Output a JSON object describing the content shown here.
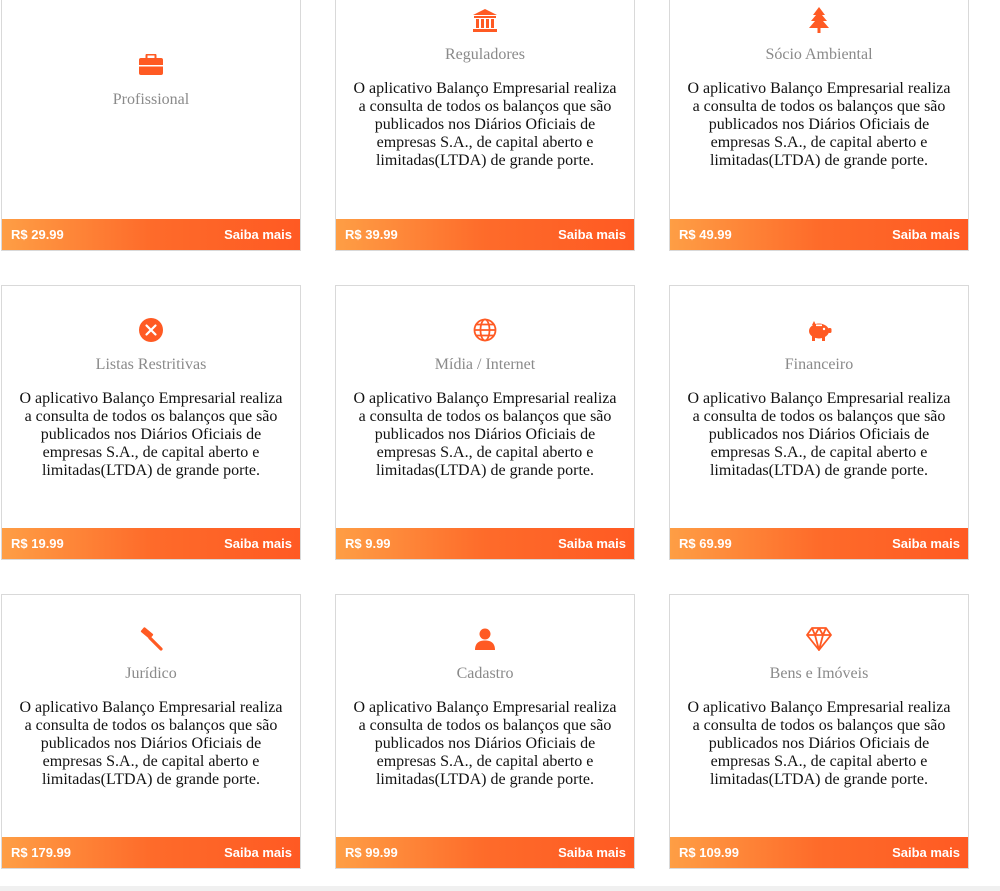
{
  "colors": {
    "accent": "#ff5a23",
    "title_gray": "#8a8a8a"
  },
  "cards": [
    {
      "icon": "briefcase-icon",
      "title": "Profissional",
      "description": "",
      "price": "R$ 29.99",
      "cta": "Saiba mais"
    },
    {
      "icon": "bank-icon",
      "title": "Reguladores",
      "description": "O aplicativo Balanço Empresarial realiza a consulta de todos os balanços que são publicados nos Diários Oficiais de empresas S.A., de capital aberto e limitadas(LTDA) de grande porte.",
      "price": "R$ 39.99",
      "cta": "Saiba mais"
    },
    {
      "icon": "tree-icon",
      "title": "Sócio Ambiental",
      "description": "O aplicativo Balanço Empresarial realiza a consulta de todos os balanços que são publicados nos Diários Oficiais de empresas S.A., de capital aberto e limitadas(LTDA) de grande porte.",
      "price": "R$ 49.99",
      "cta": "Saiba mais"
    },
    {
      "icon": "close-circle-icon",
      "title": "Listas Restritivas",
      "description": "O aplicativo Balanço Empresarial realiza a consulta de todos os balanços que são publicados nos Diários Oficiais de empresas S.A., de capital aberto e limitadas(LTDA) de grande porte.",
      "price": "R$ 19.99",
      "cta": "Saiba mais"
    },
    {
      "icon": "globe-icon",
      "title": "Mídia / Internet",
      "description": "O aplicativo Balanço Empresarial realiza a consulta de todos os balanços que são publicados nos Diários Oficiais de empresas S.A., de capital aberto e limitadas(LTDA) de grande porte.",
      "price": "R$ 9.99",
      "cta": "Saiba mais"
    },
    {
      "icon": "piggy-bank-icon",
      "title": "Financeiro",
      "description": "O aplicativo Balanço Empresarial realiza a consulta de todos os balanços que são publicados nos Diários Oficiais de empresas S.A., de capital aberto e limitadas(LTDA) de grande porte.",
      "price": "R$ 69.99",
      "cta": "Saiba mais"
    },
    {
      "icon": "gavel-icon",
      "title": "Jurídico",
      "description": "O aplicativo Balanço Empresarial realiza a consulta de todos os balanços que são publicados nos Diários Oficiais de empresas S.A., de capital aberto e limitadas(LTDA) de grande porte.",
      "price": "R$ 179.99",
      "cta": "Saiba mais"
    },
    {
      "icon": "user-icon",
      "title": "Cadastro",
      "description": "O aplicativo Balanço Empresarial realiza a consulta de todos os balanços que são publicados nos Diários Oficiais de empresas S.A., de capital aberto e limitadas(LTDA) de grande porte.",
      "price": "R$ 99.99",
      "cta": "Saiba mais"
    },
    {
      "icon": "diamond-icon",
      "title": "Bens e Imóveis",
      "description": "O aplicativo Balanço Empresarial realiza a consulta de todos os balanços que são publicados nos Diários Oficiais de empresas S.A., de capital aberto e limitadas(LTDA) de grande porte.",
      "price": "R$ 109.99",
      "cta": "Saiba mais"
    }
  ]
}
